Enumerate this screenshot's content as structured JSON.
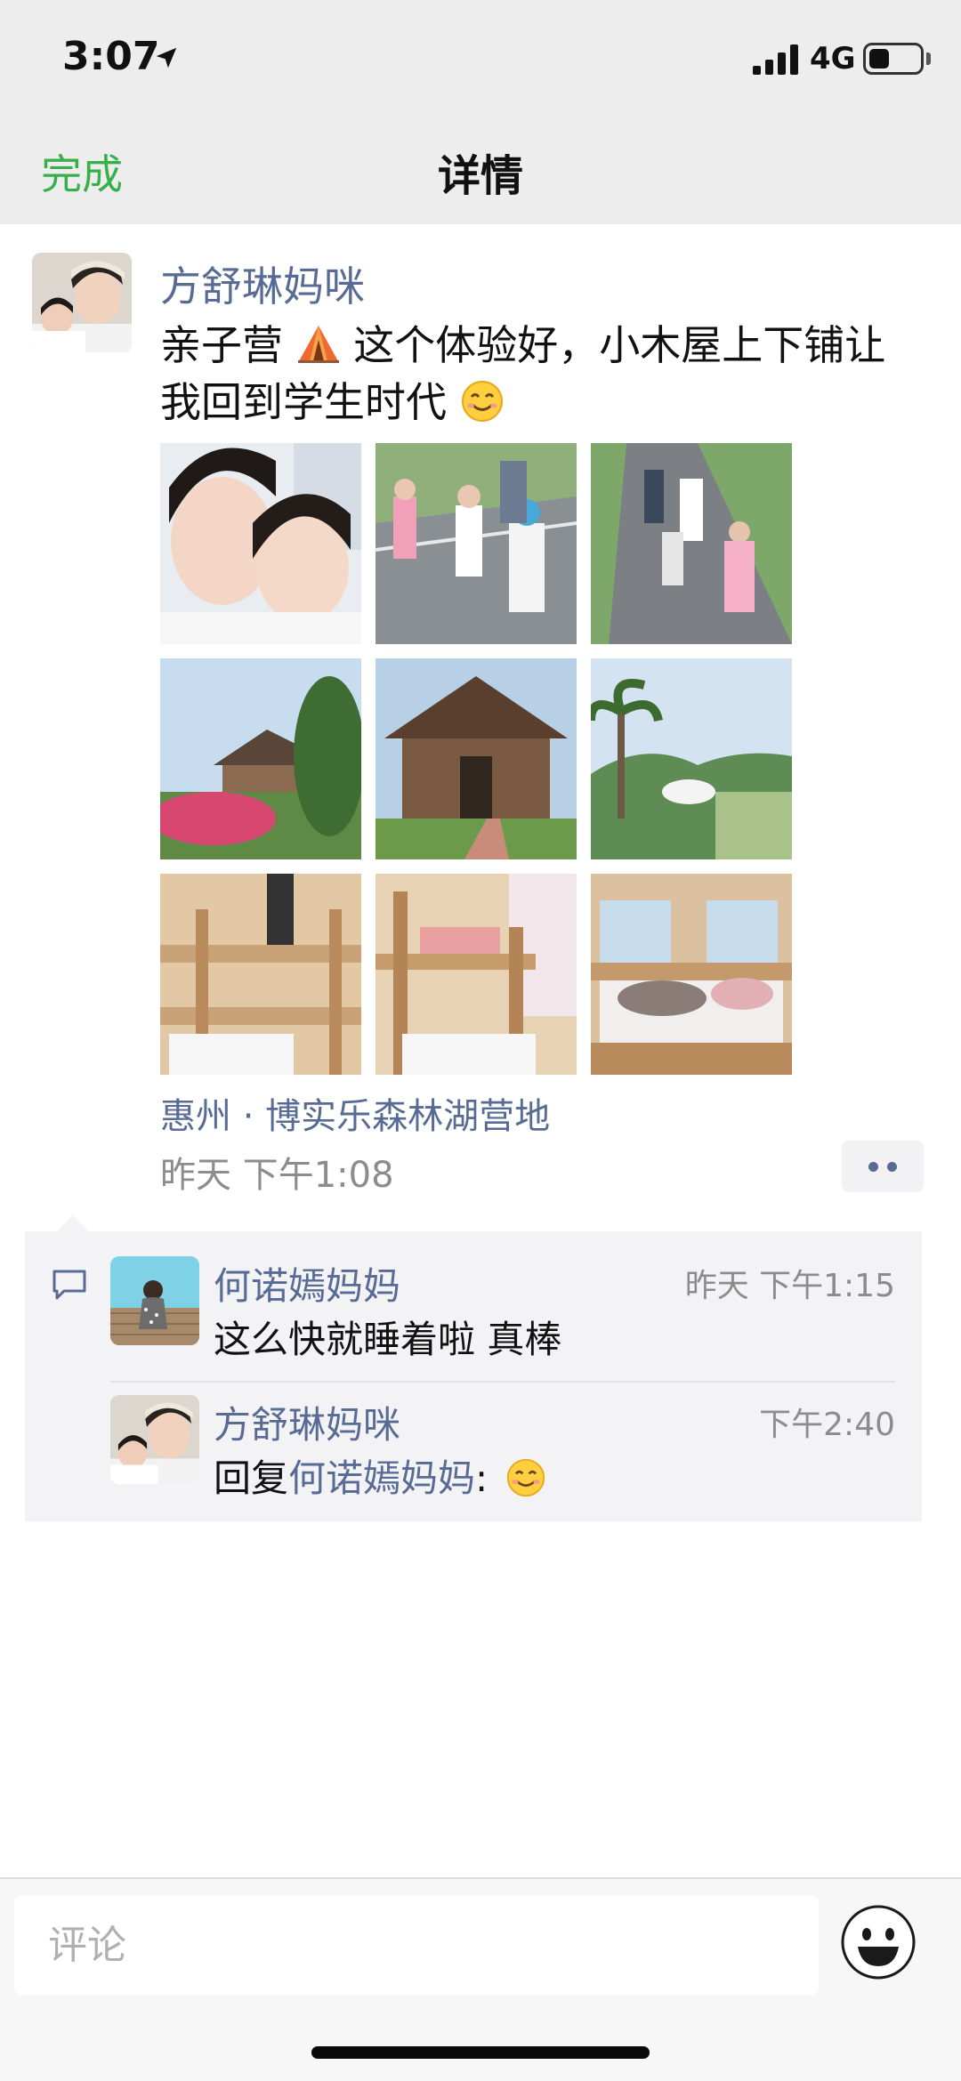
{
  "status_bar": {
    "time": "3:07",
    "network": "4G",
    "battery_level": 0.4,
    "icons": [
      "location-arrow-icon",
      "signal-icon",
      "battery-icon"
    ]
  },
  "nav": {
    "done_label": "完成",
    "title": "详情",
    "done_color": "#38b04a"
  },
  "post": {
    "author": "方舒琳妈咪",
    "text_part1": "亲子营",
    "text_part2": " 这个体验好，小木屋上下铺让我回到学生时代",
    "inline_icons": [
      "tent-icon",
      "smile-emoji-icon"
    ],
    "location": "惠州 · 博实乐森林湖营地",
    "time": "昨天 下午1:08",
    "photo_count": 9,
    "link_color": "#576b95"
  },
  "comments": [
    {
      "author": "何诺嫣妈妈",
      "time": "昨天 下午1:15",
      "text": "这么快就睡着啦 真棒"
    },
    {
      "author": "方舒琳妈咪",
      "time": "下午2:40",
      "reply_prefix": "回复",
      "reply_to": "何诺嫣妈妈",
      "reply_suffix": ":",
      "emoji": "smile-emoji-icon"
    }
  ],
  "input": {
    "placeholder": "评论",
    "emoji_button": "emoji-face-icon"
  }
}
